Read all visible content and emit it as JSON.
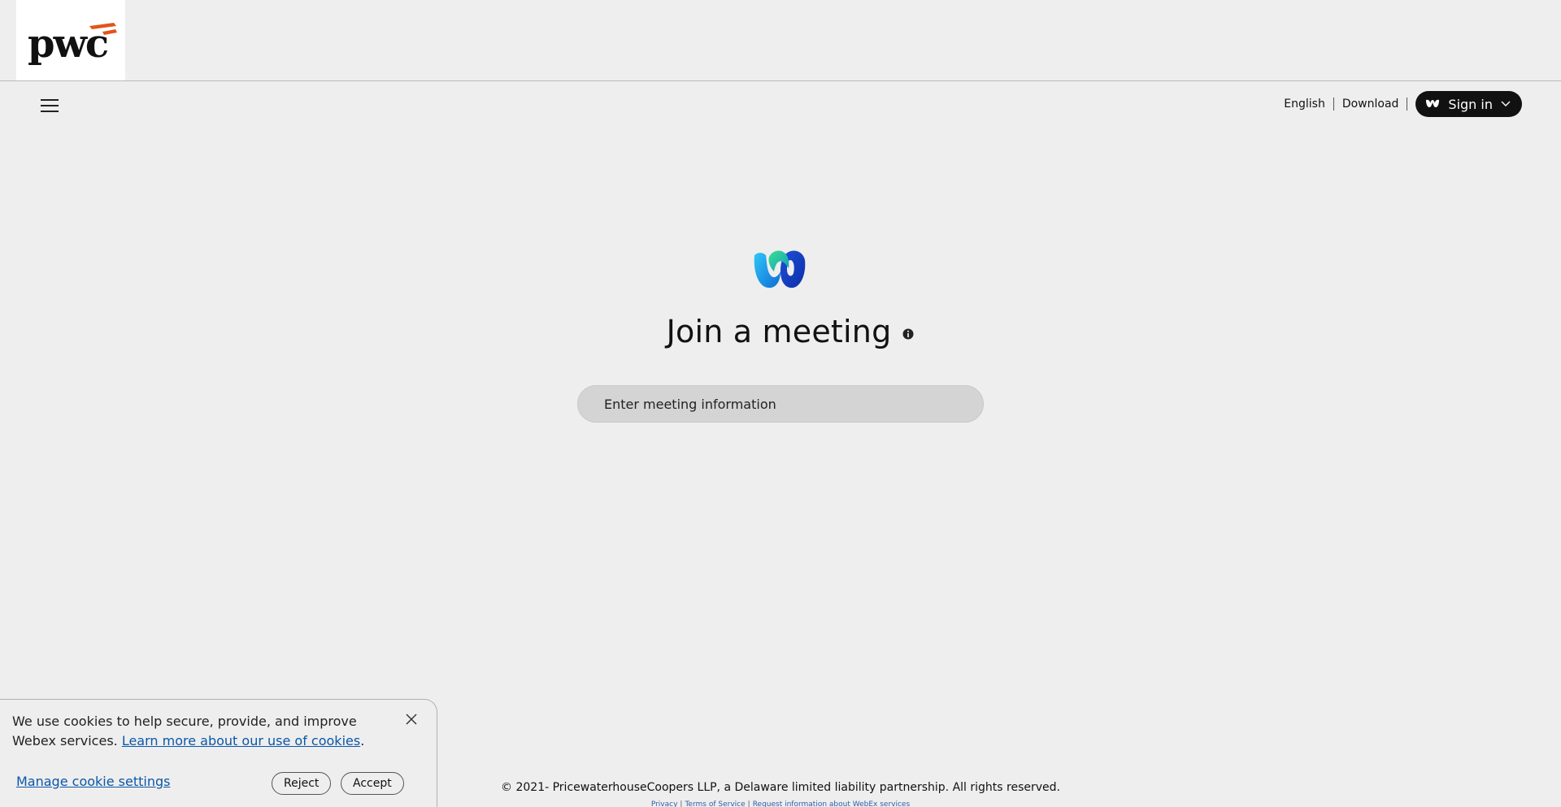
{
  "brand": {
    "logo_text": "pwc",
    "accent_color": "#e2541b"
  },
  "nav": {
    "menu_icon": "hamburger-menu-icon",
    "language": "English",
    "download": "Download",
    "sign_in": "Sign in"
  },
  "main": {
    "title": "Join a meeting",
    "meeting_input": {
      "placeholder": "Enter meeting information",
      "value": ""
    }
  },
  "footer": {
    "copyright": "© 2021- PricewaterhouseCoopers LLP, a Delaware limited liability partnership. All rights reserved.",
    "links": [
      "Privacy",
      "Terms of Service",
      "Request information about WebEx services"
    ]
  },
  "cookie_banner": {
    "text": "We use cookies to help secure, provide, and improve Webex services.",
    "learn_more": "Learn more about our use of cookies",
    "period": ".",
    "manage": "Manage cookie settings",
    "reject": "Reject",
    "accept": "Accept"
  }
}
